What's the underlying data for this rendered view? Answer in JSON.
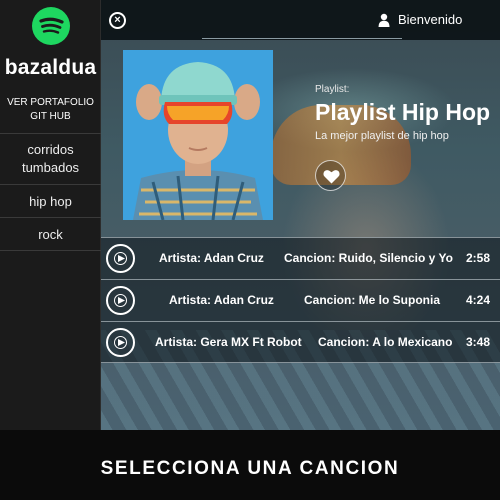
{
  "brand": {
    "logo_icon": "spotify-icon",
    "logo_color": "#1ed760",
    "name": "bazaldua"
  },
  "sidebar": {
    "links": [
      "VER PORTAFOLIO",
      "GIT HUB"
    ],
    "nav": [
      {
        "label": "corridos tumbados"
      },
      {
        "label": "hip hop"
      },
      {
        "label": "rock"
      }
    ]
  },
  "header": {
    "close_icon": "close-circle-icon",
    "user_icon": "user-icon",
    "welcome": "Bienvenido"
  },
  "playlist": {
    "label": "Playlist:",
    "title": "Playlist Hip Hop",
    "description": "La mejor playlist de hip hop",
    "like_icon": "heart-icon"
  },
  "tracks": [
    {
      "artist": "Artista: Adan Cruz",
      "song": "Cancion: Ruido, Silencio y Yo",
      "duration": "2:58"
    },
    {
      "artist": "Artista: Adan Cruz",
      "song": "Cancion: Me lo Suponia",
      "duration": "4:24"
    },
    {
      "artist": "Artista: Gera MX Ft Robot",
      "song": "Cancion: A lo Mexicano",
      "duration": "3:48"
    }
  ],
  "caption": "SELECCIONA UNA CANCION"
}
